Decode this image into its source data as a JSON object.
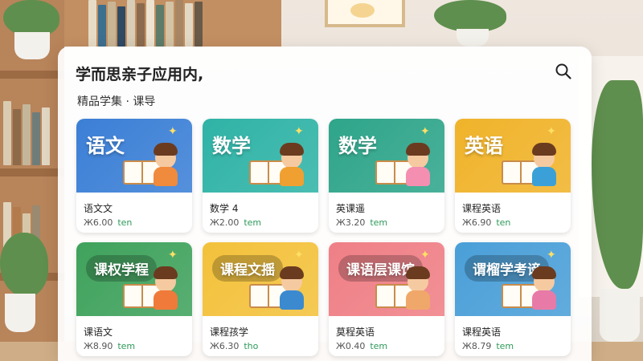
{
  "header": {
    "app_title": "学而思亲子应用内,",
    "section_label": "精品学集 · 课导",
    "search_icon": "search-icon"
  },
  "colors": {
    "panel_bg": "#ffffff",
    "price_unit": "#2f9a5b"
  },
  "courses": [
    {
      "thumb_title": "语文",
      "name": "语文文",
      "price": "Ж6.00",
      "unit": "ten",
      "thumb_color": "#3b7fd6",
      "style": "plain"
    },
    {
      "thumb_title": "数学",
      "name": "数学 4",
      "price": "Ж2.00",
      "unit": "tem",
      "thumb_color": "#2fb3a6",
      "style": "plain"
    },
    {
      "thumb_title": "数学",
      "name": "英课遥",
      "price": "Ж3.20",
      "unit": "tem",
      "thumb_color": "#2ea58a",
      "style": "plain"
    },
    {
      "thumb_title": "英语",
      "name": "课程英语",
      "price": "Ж6.90",
      "unit": "ten",
      "thumb_color": "#f0b32a",
      "style": "plain"
    },
    {
      "thumb_title": "课权学程",
      "name": "课语文",
      "price": "Ж8.90",
      "unit": "tem",
      "thumb_color": "#3fa25c",
      "style": "pill"
    },
    {
      "thumb_title": "课程文揺",
      "name": "课程孩学",
      "price": "Ж6.30",
      "unit": "tho",
      "thumb_color": "#f3c13b",
      "style": "pill"
    },
    {
      "thumb_title": "课语层课馆",
      "name": "莫程英语",
      "price": "Ж0.40",
      "unit": "tem",
      "thumb_color": "#ef7f86",
      "style": "pill"
    },
    {
      "thumb_title": "谓榴学考谛",
      "name": "课程英语",
      "price": "Ж8.79",
      "unit": "tem",
      "thumb_color": "#4a9fd8",
      "style": "pill"
    }
  ]
}
